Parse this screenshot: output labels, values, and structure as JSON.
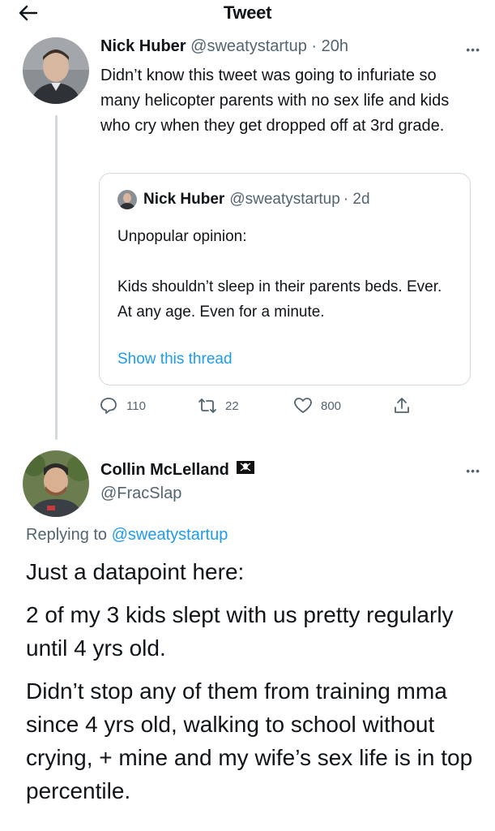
{
  "header": {
    "title": "Tweet",
    "back_icon": "arrow-left-icon"
  },
  "tweet1": {
    "name": "Nick Huber",
    "handle": "@sweatystartup",
    "time": "· 20h",
    "more_icon": "more-dots-icon",
    "text": "Didn’t know this tweet was going to infuriate so many helicopter parents with no sex life and kids who cry when they get dropped off at 3rd grade."
  },
  "quote": {
    "name": "Nick Huber",
    "handle": "@sweatystartup",
    "time": "· 2d",
    "text_p1": "Unpopular opinion:",
    "text_p2": "Kids shouldn’t sleep in their parents beds. Ever. At any age. Even for a minute.",
    "link": "Show this thread"
  },
  "actions": {
    "replies": "110",
    "retweets": "22",
    "likes": "800"
  },
  "tweet2": {
    "name": "Collin McLelland",
    "handle": "@FracSlap",
    "replying_prefix": "Replying to ",
    "replying_to": "@sweatystartup",
    "p1": "Just a datapoint here:",
    "p2": "2 of my 3 kids slept with us pretty regularly until 4 yrs old.",
    "p3": "Didn’t stop any of them from training mma since 4 yrs old, walking to school without crying, + mine and my wife’s sex life is in top percentile."
  },
  "colors": {
    "link": "#1d9bf0",
    "muted": "#536471",
    "border": "#cfd9de",
    "text": "#0f1419"
  }
}
